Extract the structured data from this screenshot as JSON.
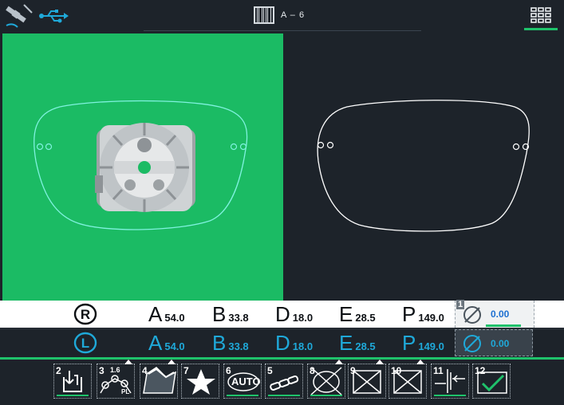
{
  "header": {
    "job_code": "A – 6",
    "icons": [
      "satellite-icon",
      "usb-icon",
      "barcode-icon",
      "grid-menu-icon"
    ]
  },
  "measurements": {
    "right": {
      "side_label": "R",
      "A": {
        "letter": "A",
        "value": "54.0"
      },
      "B": {
        "letter": "B",
        "value": "33.8"
      },
      "D": {
        "letter": "D",
        "value": "18.0"
      },
      "E": {
        "letter": "E",
        "value": "28.5"
      },
      "P": {
        "letter": "P",
        "value": "149.0"
      },
      "angle": {
        "index": "1",
        "value": "0.00"
      }
    },
    "left": {
      "side_label": "L",
      "A": {
        "letter": "A",
        "value": "54.0"
      },
      "B": {
        "letter": "B",
        "value": "33.8"
      },
      "D": {
        "letter": "D",
        "value": "18.0"
      },
      "E": {
        "letter": "E",
        "value": "28.5"
      },
      "P": {
        "letter": "P",
        "value": "149.0"
      },
      "angle": {
        "value": "0.00"
      }
    }
  },
  "toolbar": {
    "tools": [
      {
        "num": "2",
        "icon": "download-hand-icon"
      },
      {
        "num": "3",
        "label": "1.6",
        "sublabel": "PL",
        "icon": "drill-points-icon"
      },
      {
        "num": "4",
        "icon": "bevel-profile-icon"
      },
      {
        "num": "7",
        "icon": "star-icon"
      },
      {
        "num": "6",
        "label": "AUTO",
        "icon": "auto-mode-icon"
      },
      {
        "num": "5",
        "icon": "chain-link-icon"
      },
      {
        "num": "8",
        "icon": "crossed-lens-icon"
      },
      {
        "num": "9",
        "icon": "crossed-box-icon"
      },
      {
        "num": "10",
        "icon": "crossed-box-icon"
      },
      {
        "num": "11",
        "icon": "clamp-icon"
      },
      {
        "num": "12",
        "icon": "confirm-check-icon"
      }
    ]
  },
  "colors": {
    "accent_green": "#1fc26b",
    "lens_outline_left": "#7ff2de",
    "dark_bg": "#1d232a",
    "blue_value": "#1fa9d9"
  }
}
